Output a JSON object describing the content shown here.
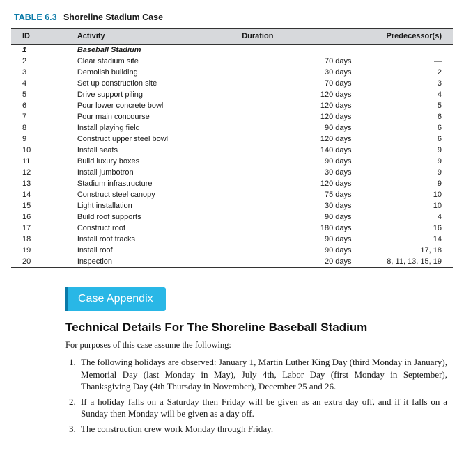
{
  "table": {
    "label": "TABLE 6.3",
    "caption": "Shoreline Stadium Case",
    "headers": [
      "ID",
      "Activity",
      "Duration",
      "Predecessor(s)"
    ],
    "rows": [
      {
        "id": "1",
        "activity": "Baseball Stadium",
        "duration": "",
        "predecessors": "",
        "section": true
      },
      {
        "id": "2",
        "activity": "Clear stadium site",
        "duration": "70 days",
        "predecessors": "—"
      },
      {
        "id": "3",
        "activity": "Demolish building",
        "duration": "30 days",
        "predecessors": "2"
      },
      {
        "id": "4",
        "activity": "Set up construction site",
        "duration": "70 days",
        "predecessors": "3"
      },
      {
        "id": "5",
        "activity": "Drive support piling",
        "duration": "120 days",
        "predecessors": "4"
      },
      {
        "id": "6",
        "activity": "Pour lower concrete bowl",
        "duration": "120 days",
        "predecessors": "5"
      },
      {
        "id": "7",
        "activity": "Pour main concourse",
        "duration": "120 days",
        "predecessors": "6"
      },
      {
        "id": "8",
        "activity": "Install playing field",
        "duration": "90 days",
        "predecessors": "6"
      },
      {
        "id": "9",
        "activity": "Construct upper steel bowl",
        "duration": "120 days",
        "predecessors": "6"
      },
      {
        "id": "10",
        "activity": "Install seats",
        "duration": "140 days",
        "predecessors": "9"
      },
      {
        "id": "11",
        "activity": "Build luxury boxes",
        "duration": "90 days",
        "predecessors": "9"
      },
      {
        "id": "12",
        "activity": "Install jumbotron",
        "duration": "30 days",
        "predecessors": "9"
      },
      {
        "id": "13",
        "activity": "Stadium infrastructure",
        "duration": "120 days",
        "predecessors": "9"
      },
      {
        "id": "14",
        "activity": "Construct steel canopy",
        "duration": "75 days",
        "predecessors": "10"
      },
      {
        "id": "15",
        "activity": "Light installation",
        "duration": "30 days",
        "predecessors": "10"
      },
      {
        "id": "16",
        "activity": "Build roof supports",
        "duration": "90 days",
        "predecessors": "4"
      },
      {
        "id": "17",
        "activity": "Construct roof",
        "duration": "180 days",
        "predecessors": "16"
      },
      {
        "id": "18",
        "activity": "Install roof tracks",
        "duration": "90 days",
        "predecessors": "14"
      },
      {
        "id": "19",
        "activity": "Install roof",
        "duration": "90 days",
        "predecessors": "17, 18"
      },
      {
        "id": "20",
        "activity": "Inspection",
        "duration": "20 days",
        "predecessors": "8, 11, 13, 15, 19"
      }
    ]
  },
  "appendix": {
    "tab_label": "Case Appendix",
    "heading": "Technical Details For The Shoreline Baseball Stadium",
    "intro": "For purposes of this case assume the following:",
    "items": [
      "The following holidays are observed: January 1, Martin Luther King Day (third Monday in January), Memorial Day (last Monday in May), July 4th, Labor Day (first Monday in September), Thanksgiving Day (4th Thursday in November), December 25 and 26.",
      "If a holiday falls on a Saturday then Friday will be given as an extra day off, and if it falls on a Sunday then Monday will be given as a day off.",
      "The construction crew work Monday through Friday."
    ]
  }
}
